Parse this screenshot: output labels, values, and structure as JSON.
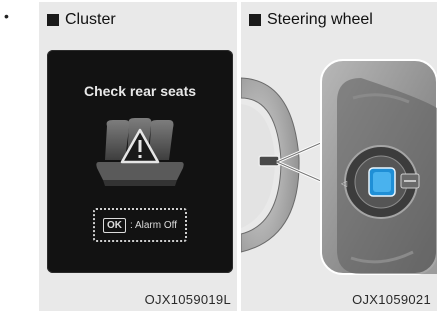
{
  "bullet": "•",
  "panels": [
    {
      "heading": "Cluster",
      "code": "OJX1059019L"
    },
    {
      "heading": "Steering wheel",
      "code": "OJX1059021"
    }
  ],
  "cluster_display": {
    "message": "Check rear seats",
    "ok_key": "OK",
    "ok_action": ": Alarm Off"
  },
  "colors": {
    "panel_bg": "#e9e9e9",
    "screen_bg": "#121212",
    "ok_button_highlight": "#1f8fd6"
  },
  "icons": [
    "rear-seat-warning-icon",
    "ok-button-icon"
  ]
}
